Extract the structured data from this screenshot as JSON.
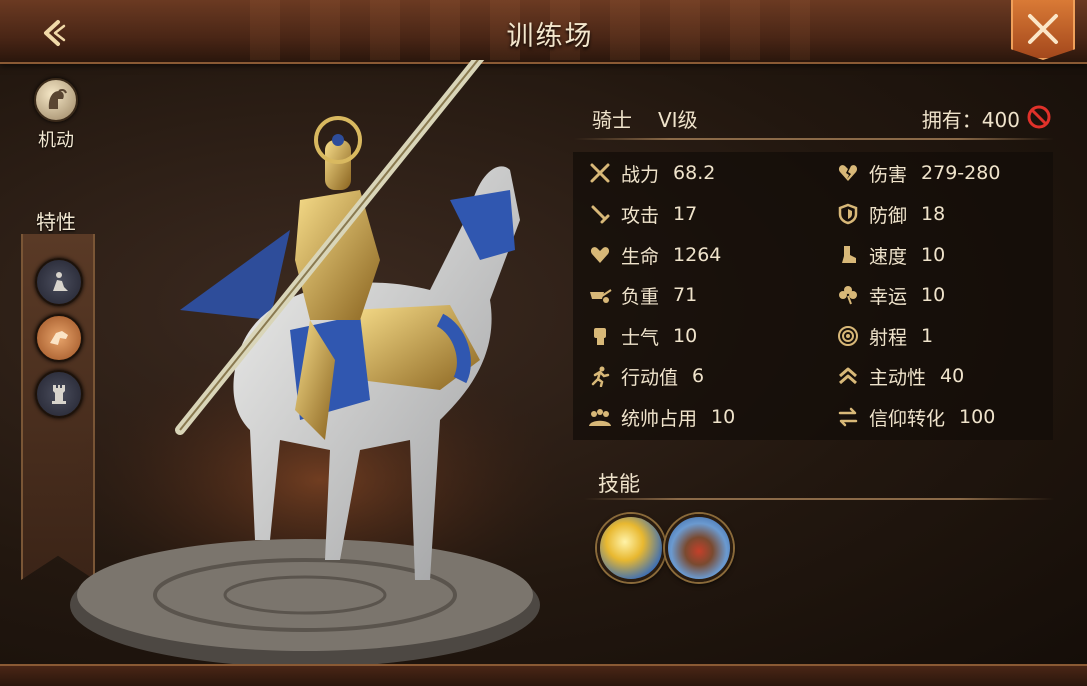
{
  "header": {
    "title": "训练场"
  },
  "left_panel": {
    "mobility_label": "机动",
    "traits_title": "特性",
    "traits": [
      {
        "icon": "crouching-figure-icon"
      },
      {
        "icon": "charging-horse-icon"
      },
      {
        "icon": "tower-icon"
      }
    ]
  },
  "unit": {
    "name": "骑士",
    "level": "VI级",
    "own_label": "拥有：400"
  },
  "stats": {
    "left": [
      {
        "icon": "crossed-swords-icon",
        "label": "战力",
        "value": "68.2"
      },
      {
        "icon": "sword-icon",
        "label": "攻击",
        "value": "17"
      },
      {
        "icon": "heart-icon",
        "label": "生命",
        "value": "1264"
      },
      {
        "icon": "wheelbarrow-icon",
        "label": "负重",
        "value": "71"
      },
      {
        "icon": "fist-icon",
        "label": "士气",
        "value": "10"
      },
      {
        "icon": "running-figure-icon",
        "label": "行动值",
        "value": "6"
      },
      {
        "icon": "crowd-icon",
        "label": "统帅占用",
        "value": "10"
      }
    ],
    "right": [
      {
        "icon": "broken-heart-icon",
        "label": "伤害",
        "value": "279-280"
      },
      {
        "icon": "shield-icon",
        "label": "防御",
        "value": "18"
      },
      {
        "icon": "boot-icon",
        "label": "速度",
        "value": "10"
      },
      {
        "icon": "clover-icon",
        "label": "幸运",
        "value": "10"
      },
      {
        "icon": "target-icon",
        "label": "射程",
        "value": "1"
      },
      {
        "icon": "double-chevron-up-icon",
        "label": "主动性",
        "value": "40"
      },
      {
        "icon": "swap-arrows-icon",
        "label": "信仰转化",
        "value": "100"
      }
    ]
  },
  "skills": {
    "title": "技能",
    "items": [
      {
        "icon": "golden-wing-skill-icon"
      },
      {
        "icon": "flaming-sword-skill-icon"
      }
    ]
  },
  "colors": {
    "header": "#4a2616",
    "close_button": "#c2622a",
    "text": "#efe3cb",
    "icon_gold": "#d8b878",
    "no_icon_red": "#e0312a"
  }
}
